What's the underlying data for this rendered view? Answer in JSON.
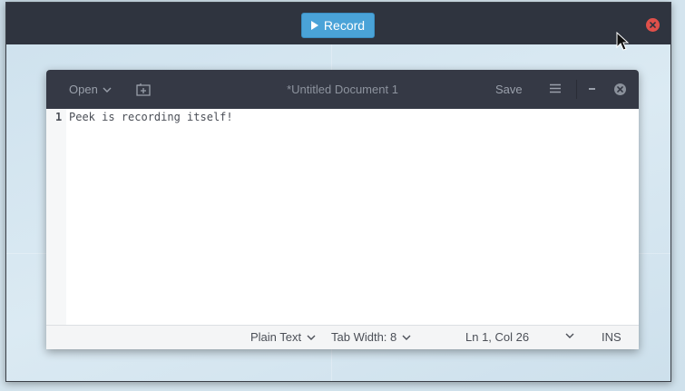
{
  "peek": {
    "record_label": "Record",
    "icons": {
      "play": "play-icon",
      "close": "close-icon"
    },
    "colors": {
      "header": "#2f343f",
      "record_button": "#4aa3d8",
      "close": "#e0504a"
    }
  },
  "gedit": {
    "open_label": "Open",
    "title": "*Untitled Document 1",
    "save_label": "Save",
    "icons": {
      "new_tab": "new-tab-icon",
      "menu": "hamburger-menu-icon",
      "minimize": "minimize-icon",
      "close": "close-icon",
      "chevron": "chevron-down-icon"
    },
    "editor": {
      "lines": [
        {
          "number": "1",
          "text": "Peek is recording itself!"
        }
      ]
    },
    "statusbar": {
      "language": "Plain Text",
      "tab_width": "Tab Width: 8",
      "position": "Ln 1, Col 26",
      "mode": "INS"
    }
  }
}
